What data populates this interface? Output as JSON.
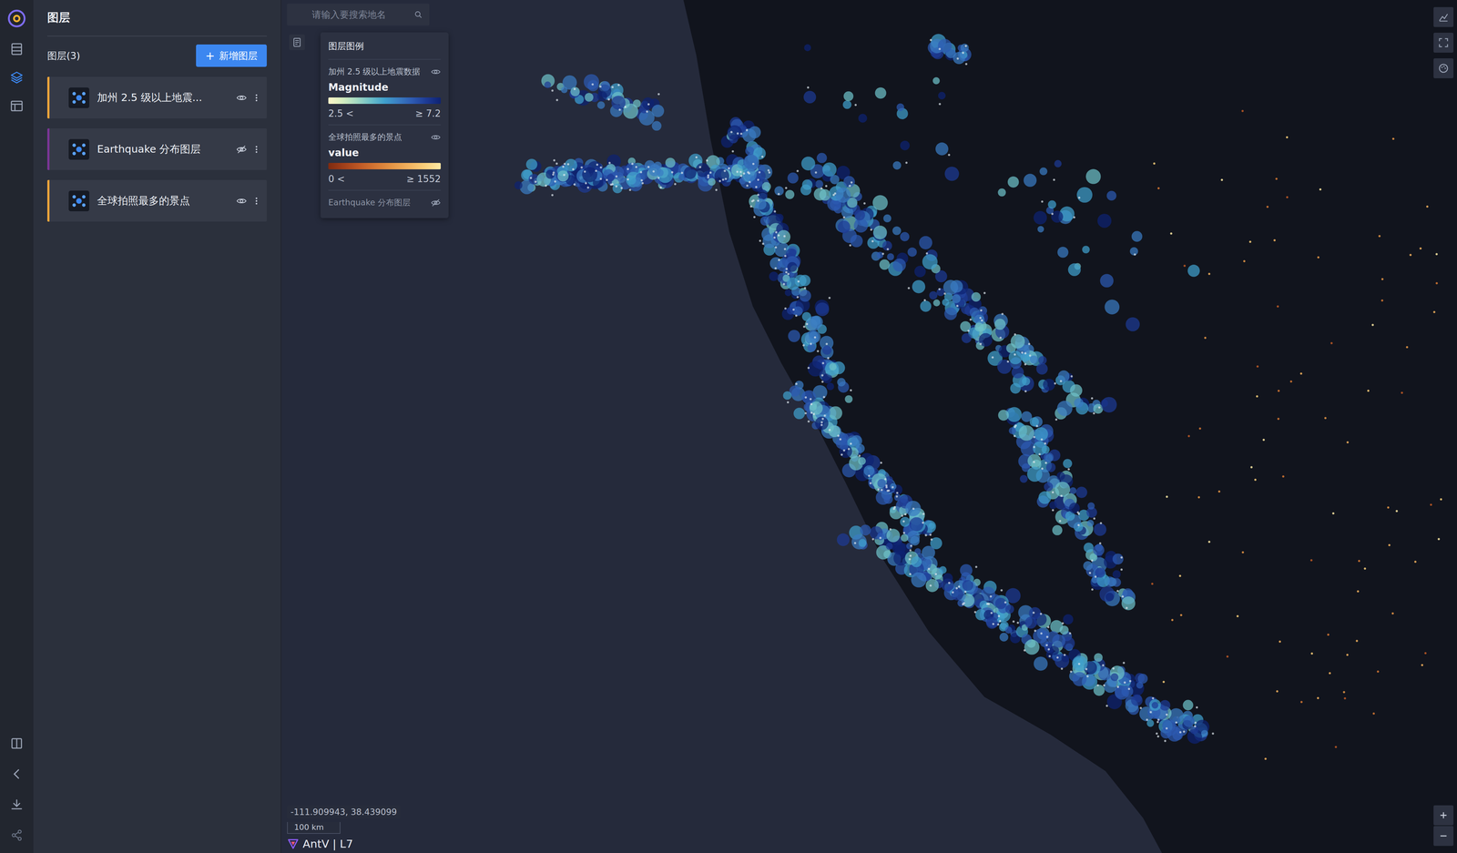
{
  "panel": {
    "title": "图层",
    "count": "图层(3)",
    "add_icon": "+",
    "add_button": "新增图层"
  },
  "layers": [
    {
      "name": "加州 2.5 级以上地震...",
      "visible": true,
      "color": "#f0a43a"
    },
    {
      "name": "Earthquake 分布图层",
      "visible": false,
      "color": "#7b3596"
    },
    {
      "name": "全球拍照最多的景点",
      "visible": true,
      "color": "#f0a43a"
    }
  ],
  "search": {
    "placeholder": "请输入要搜索地名"
  },
  "legend": {
    "title": "图层图例",
    "items": [
      {
        "name": "加州 2.5 级以上地震数据",
        "visible": true,
        "field": "Magnitude",
        "min": "2.5 <",
        "max": "≥ 7.2",
        "colors": [
          "#fdf6c8",
          "#d6eec0",
          "#a6dac2",
          "#6ec0c8",
          "#40a0cc",
          "#3a7cc2",
          "#2d5ab2",
          "#1d3a94",
          "#0e2272"
        ]
      },
      {
        "name": "全球拍照最多的景点",
        "visible": true,
        "field": "value",
        "min": "0 <",
        "max": "≥ 1552",
        "colors": [
          "#7e2a10",
          "#a2401a",
          "#c05a26",
          "#d67834",
          "#e69646",
          "#f2b25e",
          "#f9cf7a",
          "#fdeaa4"
        ]
      },
      {
        "name": "Earthquake 分布图层",
        "visible": false
      }
    ]
  },
  "map": {
    "coordinates": "-111.909943, 38.439099",
    "scale": "100 km",
    "logo": "AntV | L7",
    "coastline": [
      [
        0.342,
        0
      ],
      [
        0.353,
        0.065
      ],
      [
        0.365,
        0.163
      ],
      [
        0.381,
        0.272
      ],
      [
        0.401,
        0.359
      ],
      [
        0.425,
        0.425
      ],
      [
        0.456,
        0.501
      ],
      [
        0.48,
        0.566
      ],
      [
        0.511,
        0.654
      ],
      [
        0.551,
        0.741
      ],
      [
        0.598,
        0.817
      ],
      [
        0.654,
        0.861
      ],
      [
        0.701,
        0.904
      ],
      [
        0.733,
        0.959
      ],
      [
        0.749,
        1
      ]
    ],
    "clusters": [
      {
        "x1": 0.203,
        "y1": 0.207,
        "x2": 0.401,
        "y2": 0.202,
        "count": 170,
        "spread": 0.022
      },
      {
        "x1": 0.385,
        "y1": 0.142,
        "x2": 0.472,
        "y2": 0.458,
        "count": 140,
        "spread": 0.018
      },
      {
        "x1": 0.44,
        "y1": 0.458,
        "x2": 0.551,
        "y2": 0.626,
        "count": 110,
        "spread": 0.016
      },
      {
        "x1": 0.496,
        "y1": 0.621,
        "x2": 0.78,
        "y2": 0.861,
        "count": 230,
        "spread": 0.028
      },
      {
        "x1": 0.44,
        "y1": 0.196,
        "x2": 0.693,
        "y2": 0.49,
        "count": 160,
        "spread": 0.032
      },
      {
        "x1": 0.63,
        "y1": 0.49,
        "x2": 0.709,
        "y2": 0.697,
        "count": 100,
        "spread": 0.028
      },
      {
        "x1": 0.432,
        "y1": 0.044,
        "x2": 0.749,
        "y2": 0.327,
        "count": 40,
        "spread": 0.08
      },
      {
        "x1": 0.229,
        "y1": 0.098,
        "x2": 0.314,
        "y2": 0.131,
        "count": 40,
        "spread": 0.025
      },
      {
        "x1": 0.551,
        "y1": 0.054,
        "x2": 0.59,
        "y2": 0.065,
        "count": 15,
        "spread": 0.015
      }
    ],
    "spots": {
      "x1": 0.74,
      "y1": 0.12,
      "x2": 0.99,
      "y2": 0.95,
      "count": 90
    }
  }
}
